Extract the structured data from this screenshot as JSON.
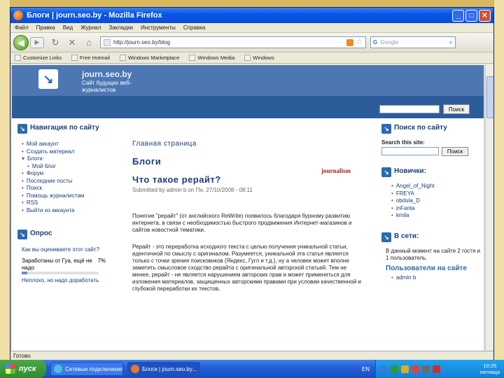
{
  "window": {
    "title": "Блоги | journ.seo.by - Mozilla Firefox",
    "minimize": "_",
    "maximize": "□",
    "close": "✕"
  },
  "menu": [
    "Файл",
    "Правка",
    "Вид",
    "Журнал",
    "Закладки",
    "Инструменты",
    "Справка"
  ],
  "nav": {
    "url": "http://journ.seo.by/blog",
    "search_placeholder": "Google",
    "search_engine": "G"
  },
  "bookmarks": [
    "Customize Links",
    "Free Hotmail",
    "Windows Marketplace",
    "Windows Media",
    "Windows"
  ],
  "site": {
    "name": "journ.seo.by",
    "slogan": "Сайт будущих веб-журналистов",
    "header_search_button": "Поиск"
  },
  "left": {
    "nav_title": "Навигация по сайту",
    "nav_items": [
      {
        "label": "Мой аккаунт",
        "type": "item"
      },
      {
        "label": "Создать материал",
        "type": "item"
      },
      {
        "label": "Блоги",
        "type": "open"
      },
      {
        "label": "Мой блог",
        "type": "sub"
      },
      {
        "label": "Форум",
        "type": "item"
      },
      {
        "label": "Последние посты",
        "type": "item"
      },
      {
        "label": "Поиск",
        "type": "item"
      },
      {
        "label": "Помощь журналистам",
        "type": "item"
      },
      {
        "label": "RSS",
        "type": "item"
      },
      {
        "label": "Выйти из аккаунта",
        "type": "item"
      }
    ],
    "poll_title": "Опрос",
    "poll_question": "Как вы оцениваете этот сайт?",
    "poll_answer_1": "Заработаны от Гуа, ещё не надо",
    "poll_answer_1_percent": "7%",
    "poll_answer_2": "Неплохо, но надо доработать"
  },
  "main": {
    "breadcrumb": "Главная страница",
    "title": "Блоги",
    "node_title": "Что такое рерайт?",
    "submitted": "Submitted by admin b on Пн, 27/10/2008 - 08:11",
    "logo_text": "journalism",
    "para1": "Понятие \"рерайт\" (от английского ReWrite) появилось благодаря бурному развитию интернета, в связи с необходимостью быстрого продвижения Интернет-магазинов и сайтов новостной тематики.",
    "para2": "Рерайт - это переработка исходного текста с целью получения уникальной статьи, идентичной по смыслу с оригиналом. Разумеется, уникальной эта статья является только с точки зрения поисковиков (Яндекс, Гугл и т.д.), ну а человек может вполне заметить смысловое сходство рерайта с оригинальной авторской статьей. Тем не менее, рерайт - не является нарушением авторских прав и может применяться для изложения материалов, защищенных авторскими правами при условии качественной и глубокой переработки их текстов."
  },
  "right": {
    "search_title": "Поиск по сайту",
    "search_label": "Search this site:",
    "search_button": "Поиск",
    "newbies_title": "Новички:",
    "newbies": [
      "Angel_of_Night",
      "FREYA",
      "obdula_D",
      "inFanta",
      "kmila"
    ],
    "online_title": "В сети:",
    "online_text": "В данный момент на сайте 2 гостя и 1 пользователь.",
    "online_users_title": "Пользователи на сайте",
    "online_users": [
      "admin b"
    ]
  },
  "status": "Готово",
  "taskbar": {
    "start": "пуск",
    "tasks": [
      "Сетевые подключения ...",
      "Блоги | journ.seo.by..."
    ],
    "lang": "EN",
    "time": "10:25",
    "day": "пятница"
  },
  "colors": {
    "site_header": "#4c77b2",
    "site_bar": "#2c5d9a",
    "link": "#1a3e7a",
    "taskbar": "#245fd6"
  }
}
